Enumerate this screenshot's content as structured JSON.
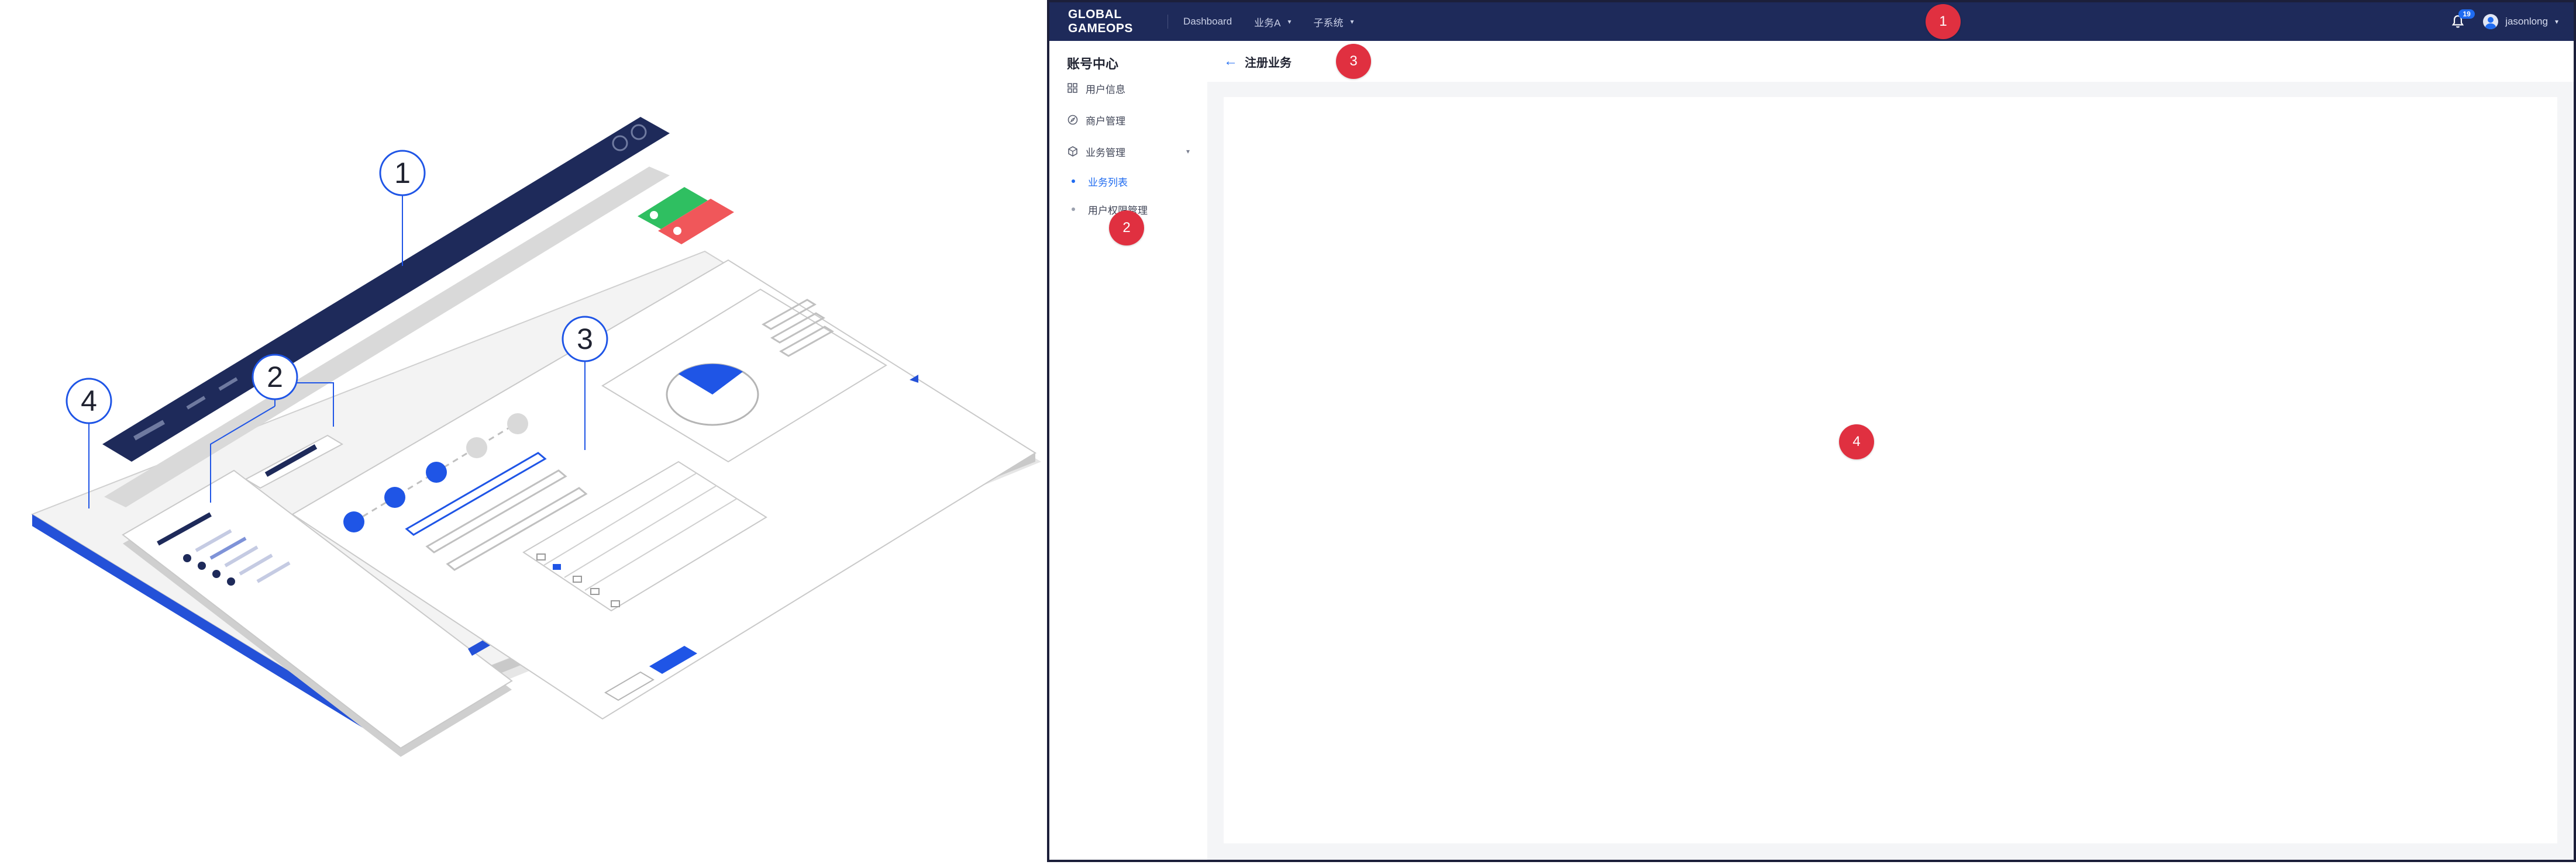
{
  "illustration": {
    "labels": [
      "1",
      "2",
      "3",
      "4"
    ]
  },
  "topbar": {
    "logo": "GLOBAL GAMEOPS",
    "nav": [
      {
        "label": "Dashboard"
      },
      {
        "label": "业务A",
        "caret": "▾"
      },
      {
        "label": "子系统",
        "caret": "▾"
      }
    ],
    "notification_count": "19",
    "username": "jasonlong",
    "user_caret": "▾"
  },
  "sidebar": {
    "title": "账号中心",
    "items": [
      {
        "label": "用户信息",
        "icon": "grid-icon"
      },
      {
        "label": "商户管理",
        "icon": "compass-icon"
      },
      {
        "label": "业务管理",
        "icon": "cube-icon",
        "caret": "▾"
      }
    ],
    "subitems": [
      {
        "label": "业务列表",
        "active": true
      },
      {
        "label": "用户权限管理",
        "active": false
      }
    ]
  },
  "content": {
    "back_icon": "arrow-left-icon",
    "title": "注册业务"
  },
  "markers": [
    "1",
    "2",
    "3",
    "4"
  ],
  "colors": {
    "topbar": "#1e2a5a",
    "accent": "#1f6bf0",
    "marker": "#e03040",
    "content_bg": "#f4f5f7"
  }
}
